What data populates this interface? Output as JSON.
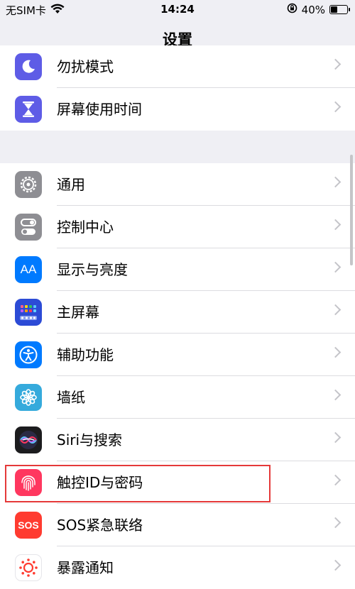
{
  "status_bar": {
    "carrier": "无SIM卡",
    "time": "14:24",
    "battery_percent": "40%",
    "battery_level": 0.4
  },
  "nav": {
    "title": "设置"
  },
  "group1": [
    {
      "label": "勿扰模式",
      "icon": "moon-icon",
      "color": "#5e5ce6"
    },
    {
      "label": "屏幕使用时间",
      "icon": "hourglass-icon",
      "color": "#5e5ce6"
    }
  ],
  "group2": [
    {
      "label": "通用",
      "icon": "gear-icon",
      "color": "#8e8e93"
    },
    {
      "label": "控制中心",
      "icon": "toggles-icon",
      "color": "#8e8e93"
    },
    {
      "label": "显示与亮度",
      "icon": "text-size-icon",
      "icon_text": "AA",
      "color": "#007aff"
    },
    {
      "label": "主屏幕",
      "icon": "home-grid-icon",
      "color": "#2c4bd6"
    },
    {
      "label": "辅助功能",
      "icon": "accessibility-icon",
      "color": "#007aff"
    },
    {
      "label": "墙纸",
      "icon": "flower-icon",
      "color": "#35aadc"
    },
    {
      "label": "Siri与搜索",
      "icon": "siri-icon",
      "color": "#1c1c1e"
    },
    {
      "label": "触控ID与密码",
      "icon": "fingerprint-icon",
      "color": "#ff375f"
    },
    {
      "label": "SOS紧急联络",
      "icon": "sos-icon",
      "icon_text": "SOS",
      "color": "#ff3b30"
    },
    {
      "label": "暴露通知",
      "icon": "exposure-icon",
      "color": "#ffffff"
    }
  ]
}
